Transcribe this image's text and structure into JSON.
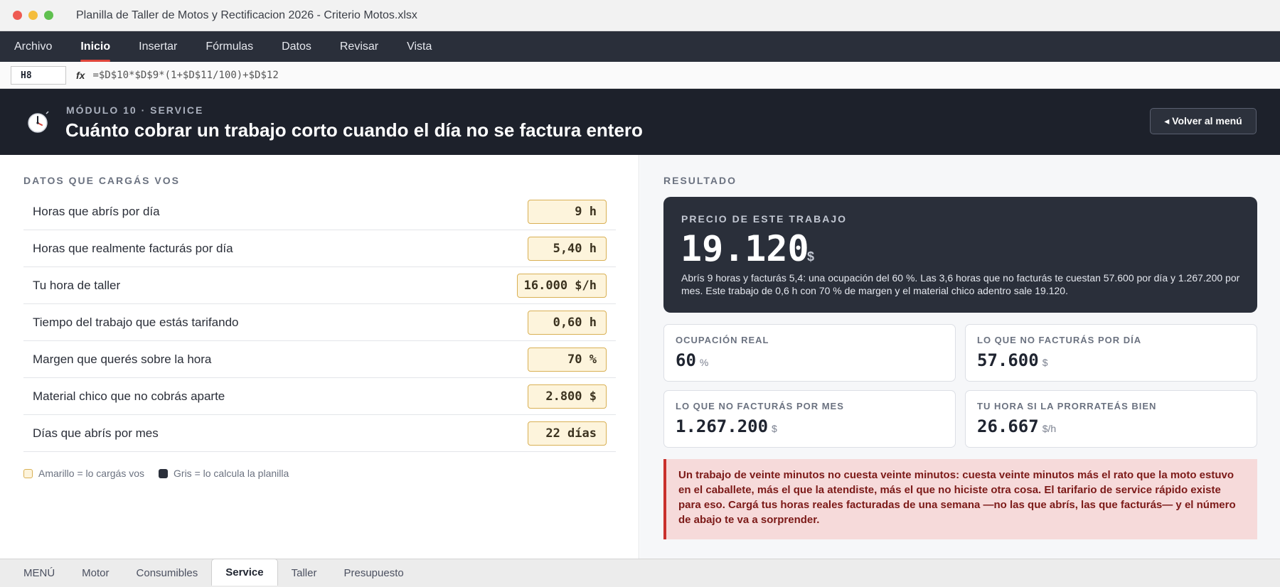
{
  "window": {
    "title": "Planilla de Taller de Motos y Rectificacion 2026 - Criterio Motos.xlsx",
    "traffic_colors": [
      "#ee5a52",
      "#f4bd3c",
      "#5fc04f"
    ]
  },
  "menu": [
    "Archivo",
    "Inicio",
    "Insertar",
    "Fórmulas",
    "Datos",
    "Revisar",
    "Vista"
  ],
  "menu_active": "Inicio",
  "formula_bar": {
    "cell": "H8",
    "fx": "fx",
    "formula": "=$D$10*$D$9*(1+$D$11/100)+$D$12"
  },
  "header": {
    "eyebrow": "MÓDULO 10 · SERVICE",
    "title": "Cuánto cobrar un trabajo corto cuando el día no se factura entero",
    "back_button": "◂ Volver al menú",
    "icon": "clock-icon"
  },
  "inputs": {
    "section_label": "DATOS QUE CARGÁS VOS",
    "rows": [
      {
        "label": "Horas que abrís por día",
        "value": "9 h"
      },
      {
        "label": "Horas que realmente facturás por día",
        "value": "5,40 h"
      },
      {
        "label": "Tu hora de taller",
        "value": "16.000 $/h"
      },
      {
        "label": "Tiempo del trabajo que estás tarifando",
        "value": "0,60 h"
      },
      {
        "label": "Margen que querés sobre la hora",
        "value": "70 %"
      },
      {
        "label": "Material chico que no cobrás aparte",
        "value": "2.800 $"
      },
      {
        "label": "Días que abrís por mes",
        "value": "22 días"
      }
    ],
    "legend_input": "Amarillo = lo cargás vos",
    "legend_calc": "Gris = lo calcula la planilla"
  },
  "result": {
    "section_label": "RESULTADO",
    "price_label": "PRECIO DE ESTE TRABAJO",
    "price_value": "19.120",
    "price_unit": "$",
    "description": "Abrís 9 horas y facturás 5,4: una ocupación del 60 %. Las 3,6 horas que no facturás te cuestan 57.600 por día y 1.267.200 por mes. Este trabajo de 0,6 h con 70 % de margen y el material chico adentro sale 19.120.",
    "metrics": [
      {
        "label": "OCUPACIÓN REAL",
        "value": "60",
        "unit": "%"
      },
      {
        "label": "LO QUE NO FACTURÁS POR DÍA",
        "value": "57.600",
        "unit": "$"
      },
      {
        "label": "LO QUE NO FACTURÁS POR MES",
        "value": "1.267.200",
        "unit": "$"
      },
      {
        "label": "TU HORA SI LA PRORRATEÁS BIEN",
        "value": "26.667",
        "unit": "$/h"
      }
    ],
    "alert": "Un trabajo de veinte minutos no cuesta veinte minutos: cuesta veinte minutos más el rato que la moto estuvo en el caballete, más el que la atendiste, más el que no hiciste otra cosa. El tarifario de service rápido existe para eso. Cargá tus horas reales facturadas de una semana —no las que abrís, las que facturás— y el número de abajo te va a sorprender."
  },
  "sheet_tabs": [
    "MENÚ",
    "Motor",
    "Consumibles",
    "Service",
    "Taller",
    "Presupuesto"
  ],
  "sheet_active": "Service"
}
